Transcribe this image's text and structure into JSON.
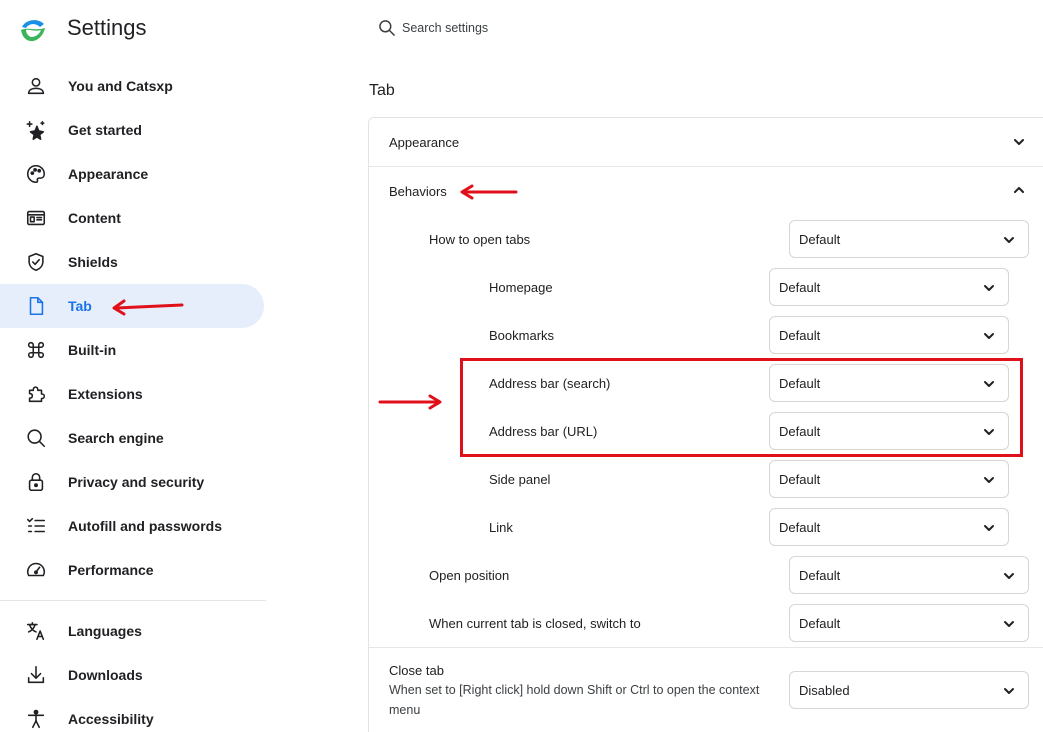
{
  "app": {
    "title": "Settings"
  },
  "search": {
    "placeholder": "Search settings"
  },
  "sidebar": {
    "items": [
      {
        "label": "You and Catsxp",
        "icon": "person-icon"
      },
      {
        "label": "Get started",
        "icon": "sparkle-star-icon"
      },
      {
        "label": "Appearance",
        "icon": "palette-icon"
      },
      {
        "label": "Content",
        "icon": "content-icon"
      },
      {
        "label": "Shields",
        "icon": "shield-icon"
      },
      {
        "label": "Tab",
        "icon": "document-icon",
        "active": true
      },
      {
        "label": "Built-in",
        "icon": "cloverleaf-icon"
      },
      {
        "label": "Extensions",
        "icon": "puzzle-icon"
      },
      {
        "label": "Search engine",
        "icon": "search-icon"
      },
      {
        "label": "Privacy and security",
        "icon": "lock-icon"
      },
      {
        "label": "Autofill and passwords",
        "icon": "checklist-icon"
      },
      {
        "label": "Performance",
        "icon": "speedometer-icon"
      },
      {
        "label": "Languages",
        "icon": "translate-icon"
      },
      {
        "label": "Downloads",
        "icon": "download-icon"
      },
      {
        "label": "Accessibility",
        "icon": "accessibility-icon"
      }
    ]
  },
  "main": {
    "section_title": "Tab",
    "appearance": {
      "label": "Appearance",
      "expanded": false
    },
    "behaviors": {
      "label": "Behaviors",
      "expanded": true,
      "how_to_open_tabs": {
        "label": "How to open tabs",
        "value": "Default"
      },
      "sub_settings": [
        {
          "label": "Homepage",
          "value": "Default"
        },
        {
          "label": "Bookmarks",
          "value": "Default"
        },
        {
          "label": "Address bar (search)",
          "value": "Default"
        },
        {
          "label": "Address bar (URL)",
          "value": "Default"
        },
        {
          "label": "Side panel",
          "value": "Default"
        },
        {
          "label": "Link",
          "value": "Default"
        }
      ],
      "open_position": {
        "label": "Open position",
        "value": "Default"
      },
      "switch_on_close": {
        "label": "When current tab is closed, switch to",
        "value": "Default"
      }
    },
    "close_tab": {
      "label": "Close tab",
      "description": "When set to [Right click] hold down Shift or Ctrl to open the context menu",
      "value": "Disabled"
    }
  },
  "colors": {
    "accent": "#1a73e8",
    "active_bg": "#e6eefc",
    "annotation_red": "#e0101b"
  }
}
